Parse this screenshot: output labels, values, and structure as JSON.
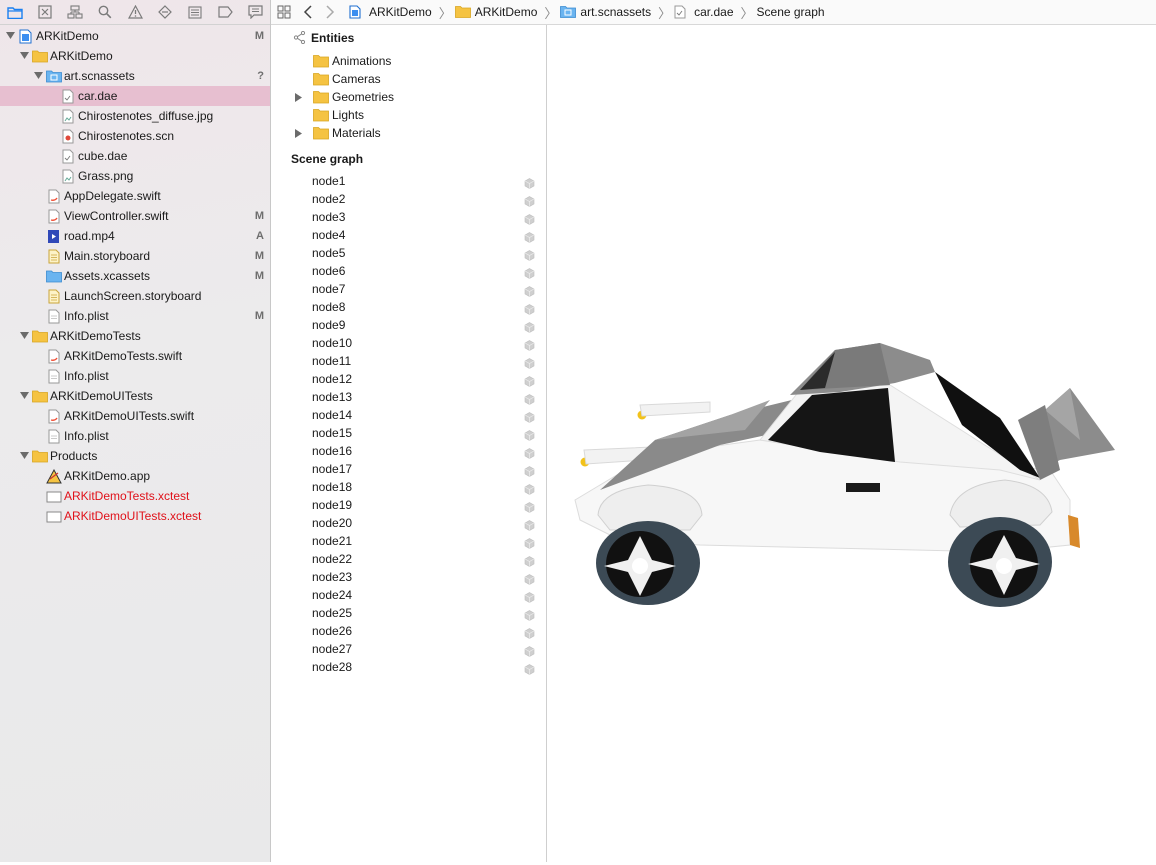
{
  "navigator": {
    "toolbar_icons": [
      "folder-icon",
      "source-control-icon",
      "hierarchy-icon",
      "search-icon",
      "warning-icon",
      "test-diamond-icon",
      "debug-list-icon",
      "breakpoint-icon",
      "report-icon"
    ],
    "rows": [
      {
        "label": "ARKitDemo",
        "status": "M"
      },
      {
        "label": "ARKitDemo",
        "status": ""
      },
      {
        "label": "art.scnassets",
        "status": "?"
      },
      {
        "label": "car.dae",
        "status": ""
      },
      {
        "label": "Chirostenotes_diffuse.jpg",
        "status": ""
      },
      {
        "label": "Chirostenotes.scn",
        "status": ""
      },
      {
        "label": "cube.dae",
        "status": ""
      },
      {
        "label": "Grass.png",
        "status": ""
      },
      {
        "label": "AppDelegate.swift",
        "status": ""
      },
      {
        "label": "ViewController.swift",
        "status": "M"
      },
      {
        "label": "road.mp4",
        "status": "A"
      },
      {
        "label": "Main.storyboard",
        "status": "M"
      },
      {
        "label": "Assets.xcassets",
        "status": "M"
      },
      {
        "label": "LaunchScreen.storyboard",
        "status": ""
      },
      {
        "label": "Info.plist",
        "status": "M"
      },
      {
        "label": "ARKitDemoTests",
        "status": ""
      },
      {
        "label": "ARKitDemoTests.swift",
        "status": ""
      },
      {
        "label": "Info.plist",
        "status": ""
      },
      {
        "label": "ARKitDemoUITests",
        "status": ""
      },
      {
        "label": "ARKitDemoUITests.swift",
        "status": ""
      },
      {
        "label": "Info.plist",
        "status": ""
      },
      {
        "label": "Products",
        "status": ""
      },
      {
        "label": "ARKitDemo.app",
        "status": ""
      },
      {
        "label": "ARKitDemoTests.xctest",
        "status": ""
      },
      {
        "label": "ARKitDemoUITests.xctest",
        "status": ""
      }
    ]
  },
  "jumpbar": {
    "crumbs": [
      "ARKitDemo",
      "ARKitDemo",
      "art.scnassets",
      "car.dae",
      "Scene graph"
    ]
  },
  "outline": {
    "entities_title": "Entities",
    "entities": [
      "Animations",
      "Cameras",
      "Geometries",
      "Lights",
      "Materials"
    ],
    "scene_graph_title": "Scene graph",
    "nodes": [
      "node1",
      "node2",
      "node3",
      "node4",
      "node5",
      "node6",
      "node7",
      "node8",
      "node9",
      "node10",
      "node11",
      "node12",
      "node13",
      "node14",
      "node15",
      "node16",
      "node17",
      "node18",
      "node19",
      "node20",
      "node21",
      "node22",
      "node23",
      "node24",
      "node25",
      "node26",
      "node27",
      "node28"
    ]
  },
  "colors": {
    "accent": "#1a7ff0",
    "selection": "#e7bfd0",
    "folder": "#f5c342",
    "error_text": "#e0111a"
  }
}
